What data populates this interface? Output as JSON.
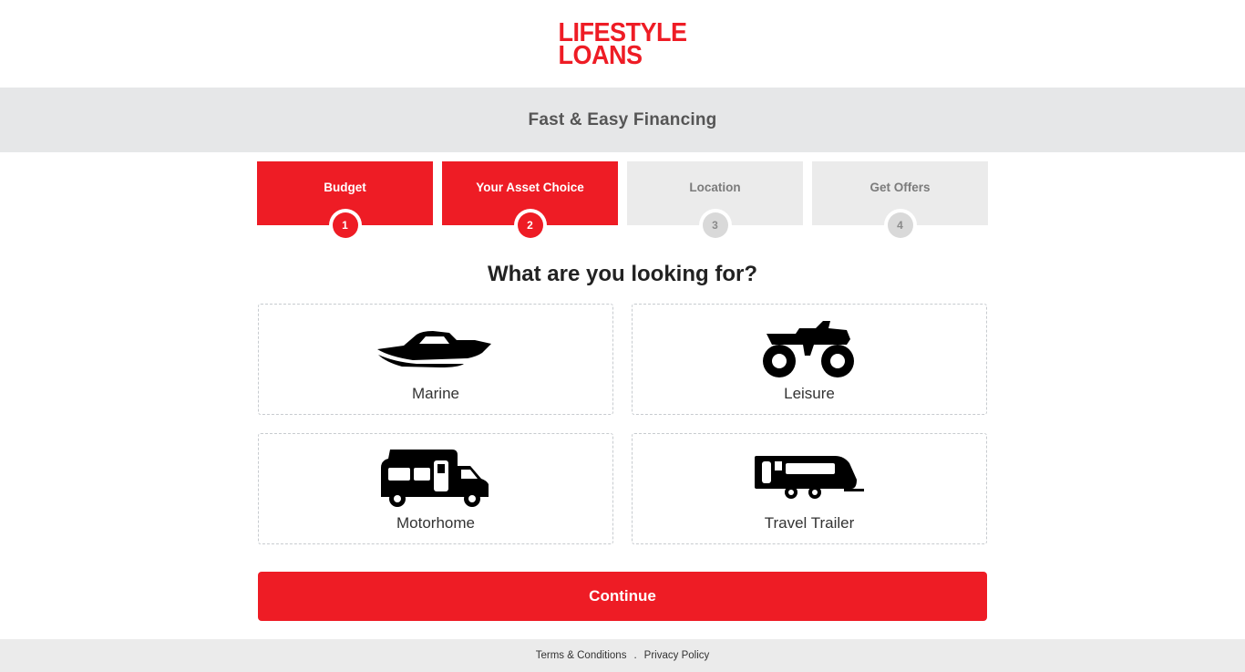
{
  "brand": {
    "line1": "LIFESTYLE",
    "line2": "LOANS"
  },
  "banner": {
    "title": "Fast & Easy Financing"
  },
  "steps": [
    {
      "label": "Budget",
      "number": "1",
      "state": "active"
    },
    {
      "label": "Your Asset Choice",
      "number": "2",
      "state": "active"
    },
    {
      "label": "Location",
      "number": "3",
      "state": "inactive"
    },
    {
      "label": "Get Offers",
      "number": "4",
      "state": "inactive"
    }
  ],
  "question": "What are you looking for?",
  "options": [
    {
      "label": "Marine",
      "icon": "boat-icon"
    },
    {
      "label": "Leisure",
      "icon": "atv-icon"
    },
    {
      "label": "Motorhome",
      "icon": "motorhome-icon"
    },
    {
      "label": "Travel Trailer",
      "icon": "travel-trailer-icon"
    }
  ],
  "continue_label": "Continue",
  "footer": {
    "terms": "Terms & Conditions",
    "separator": ".",
    "privacy": "Privacy Policy"
  },
  "colors": {
    "accent": "#ee1c25",
    "banner_bg": "#e6e7e8",
    "inactive_step": "#ebebeb"
  }
}
